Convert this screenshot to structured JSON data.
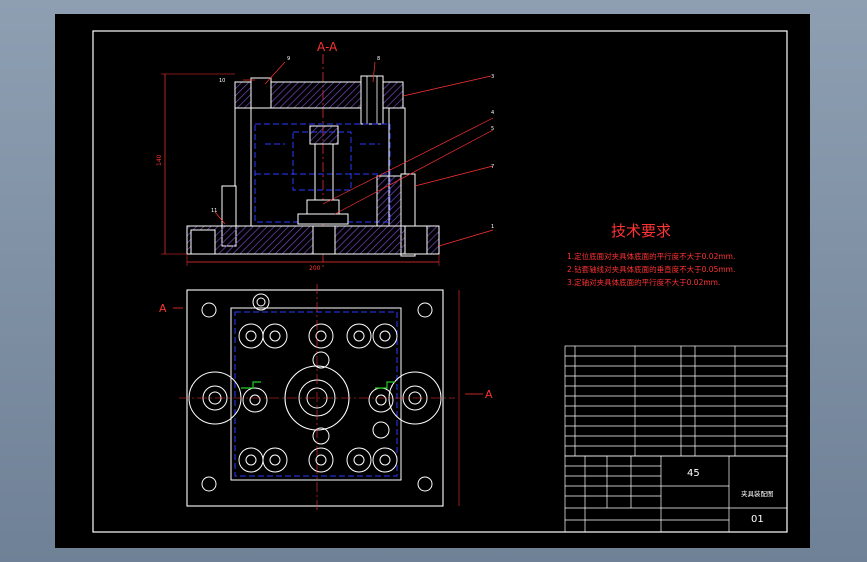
{
  "drawing": {
    "section_label": "A-A",
    "view_label_left": "A",
    "view_label_right": "A",
    "tech_title": "技术要求",
    "tech_notes": [
      "1.定位底面对夹具体底面的平行度不大于0.02mm.",
      "2.钻套轴线对夹具体底面的垂直度不大于0.05mm.",
      "3.定轴对夹具体底面的平行度不大于0.02mm."
    ],
    "dim_height": "140",
    "dim_width": "200",
    "balloons": [
      "10",
      "9",
      "8",
      "3",
      "4",
      "5",
      "7",
      "1",
      "11"
    ],
    "material": "45",
    "part_title": "夹具装配图",
    "drawing_number": "01",
    "colors": {
      "outline": "#ffffff",
      "hatch": "#7a4ec8",
      "hidden": "#2a3cff",
      "annotation": "#ff2a2a",
      "center": "#ff3333",
      "highlight": "#22cc22"
    }
  }
}
